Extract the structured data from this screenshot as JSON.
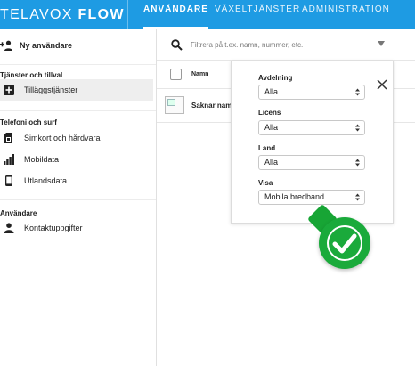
{
  "topbar": {
    "brand_light": "TELAVOX",
    "brand_bold": "FLOW",
    "nav": [
      "ANVÄNDARE",
      "VÄXELTJÄNSTER",
      "ADMINISTRATION"
    ],
    "active_index": 0,
    "background": "#1e9be3"
  },
  "sidebar": {
    "new_user": {
      "label": "Ny användare",
      "icon": "add-user-icon"
    },
    "sections": [
      {
        "heading": "Tjänster och tillval",
        "items": [
          {
            "label": "Tilläggstjänster",
            "icon": "add-box-icon",
            "selected": true
          }
        ]
      },
      {
        "heading": "Telefoni och surf",
        "items": [
          {
            "label": "Simkort och hårdvara",
            "icon": "sim-card-icon"
          },
          {
            "label": "Mobildata",
            "icon": "signal-bars-icon"
          },
          {
            "label": "Utlandsdata",
            "icon": "phone-icon"
          }
        ]
      },
      {
        "heading": "Användare",
        "items": [
          {
            "label": "Kontaktuppgifter",
            "icon": "person-icon"
          }
        ]
      }
    ]
  },
  "search": {
    "placeholder": "Filtrera på t.ex. namn, nummer, etc.",
    "value": ""
  },
  "table": {
    "columns": [
      "Namn"
    ],
    "rows": [
      {
        "name": "Saknar namn"
      }
    ]
  },
  "filter_popup": {
    "fields": [
      {
        "label": "Avdelning",
        "value": "Alla"
      },
      {
        "label": "Licens",
        "value": "Alla"
      },
      {
        "label": "Land",
        "value": "Alla"
      },
      {
        "label": "Visa",
        "value": "Mobila bredband"
      }
    ]
  },
  "badge": {
    "icon": "checkmark-icon",
    "color": "#1aaa3b"
  }
}
